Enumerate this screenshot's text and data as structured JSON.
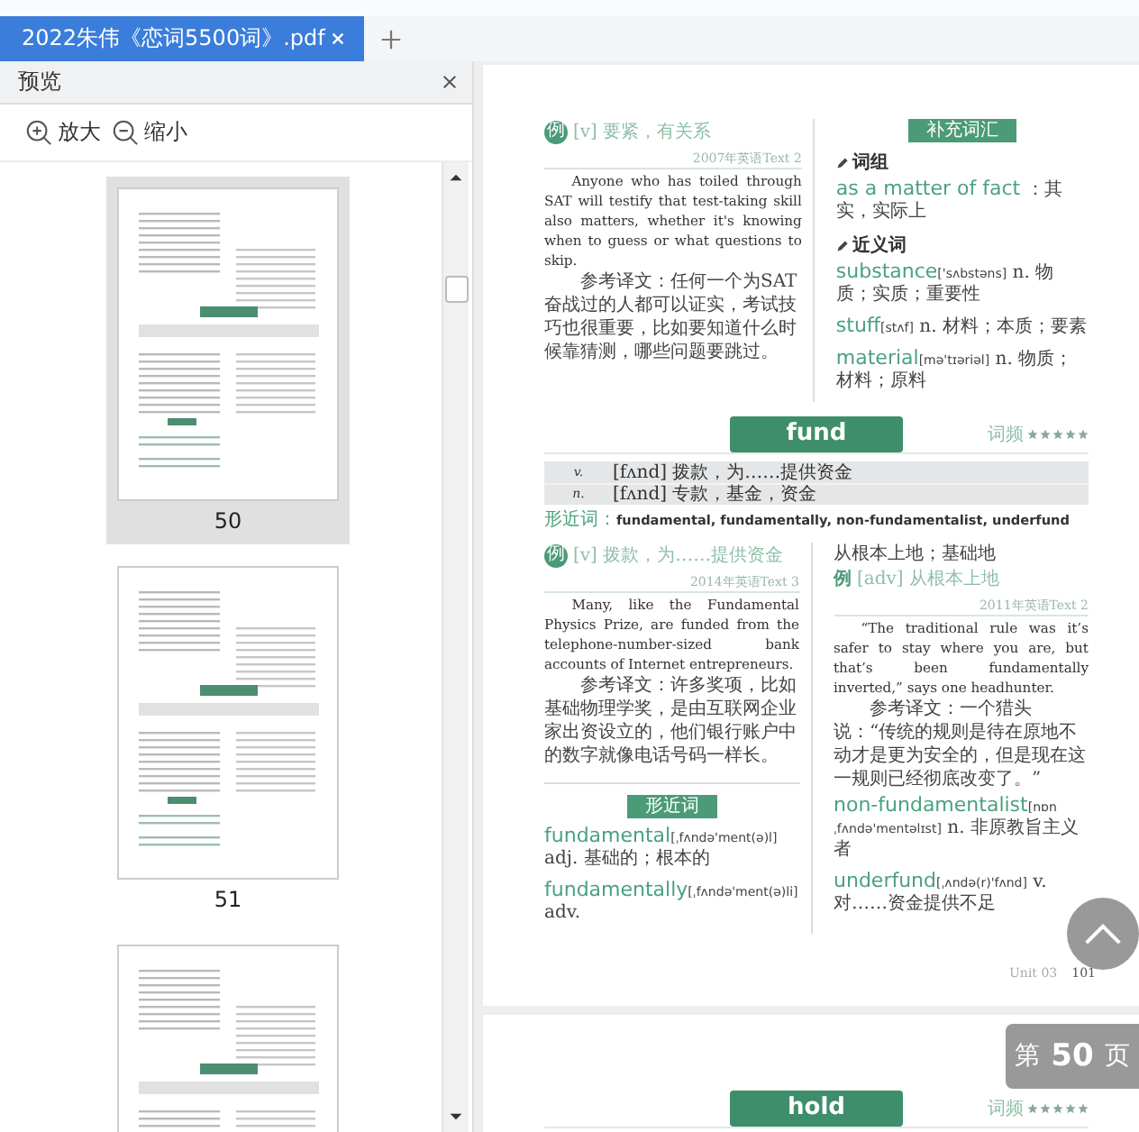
{
  "tab_bar": {
    "tabs": [
      {
        "label": "2022朱伟《恋词5500词》.pdf",
        "selected": true
      }
    ]
  },
  "sidebar": {
    "title": "预览",
    "zoom_in": "放大",
    "zoom_out": "缩小",
    "thumbnails": [
      {
        "page": "50",
        "selected": true
      },
      {
        "page": "51",
        "selected": false
      },
      {
        "selected": false
      }
    ]
  },
  "document": {
    "example_1": {
      "kind": "circle",
      "badge": "例",
      "sense": "[v] 要紧，有关系",
      "source": "2007年英语Text 2",
      "english": "Anyone who has toiled through SAT will testify that test-taking skill also matters, whether it's knowing when to guess or what questions to skip.",
      "translation": "参考译文：任何一个为SAT奋战过的人都可以证实，考试技巧也很重要，比如要知道什么时候靠猜测，哪些问题要跳过。"
    },
    "supplement": {
      "title": "补充词汇",
      "sections": [
        {
          "heading": "词组",
          "entries": [
            {
              "word": "as a matter of fact",
              "definition": "：其实，实际上"
            }
          ]
        },
        {
          "heading": "近义词",
          "entries": [
            {
              "word": "substance",
              "phonetic": "['sʌbstəns]",
              "definition": "n. 物质；实质；重要性"
            },
            {
              "word": "stuff",
              "phonetic": "[stʌf]",
              "definition": "n. 材料；本质；要素"
            },
            {
              "word": "material",
              "phonetic": "[mə'tɪəriəl]",
              "definition": "n. 物质；材料；原料"
            }
          ]
        }
      ]
    },
    "word_banner": {
      "word": "fund",
      "frequency_label": "词频",
      "stars": 5
    },
    "definitions": [
      {
        "pos": "v.",
        "text": "[fʌnd] 拨款，为……提供资金"
      },
      {
        "pos": "n.",
        "text": "[fʌnd] 专款，基金，资金"
      }
    ],
    "similar_words": {
      "label": "形近词：",
      "words": "fundamental, fundamentally, non-fundamentalist, underfund"
    },
    "example_2": {
      "kind": "circle",
      "badge": "例",
      "sense": "[v] 拨款，为……提供资金",
      "source": "2014年英语Text 3",
      "english": "Many, like the Fundamental Physics Prize, are funded from the telephone-number-sized bank accounts of Internet entrepreneurs.",
      "translation": "参考译文：许多奖项，比如基础物理学奖，是由互联网企业家出资设立的，他们银行账户中的数字就像电话号码一样长。"
    },
    "similar_section": {
      "title": "形近词",
      "entries": [
        {
          "word": "fundamental",
          "phonetic": "[ˌfʌndə'ment(ə)l]",
          "definition": "adj. 基础的；根本的"
        },
        {
          "word": "fundamentally",
          "phonetic": "[ˌfʌndə'ment(ə)li]",
          "definition": "adv."
        }
      ]
    },
    "continuation": "从根本上地；基础地",
    "example_3": {
      "kind": "inline",
      "badge": "例",
      "sense": "[adv] 从根本上地",
      "source": "2011年英语Text 2",
      "english": "“The traditional rule was it’s safer to stay where you are, but that’s been fundamentally inverted,” says one headhunter.",
      "translation": "参考译文：一个猎头说：“传统的规则是待在原地不动才是更为安全的，但是现在这一规则已经彻底改变了。”"
    },
    "right_entries": [
      {
        "word": "non-fundamentalist",
        "phonetic": "[nɒnˌfʌndə'mentəlɪst]",
        "definition": "n. 非原教旨主义者"
      },
      {
        "word": "underfund",
        "phonetic": "[ˌʌndə(r)'fʌnd]",
        "definition": "v. 对……资金提供不足"
      }
    ],
    "footer": {
      "unit": "Unit 03",
      "page": "101"
    }
  },
  "next_page": {
    "word_banner": {
      "word": "hold",
      "frequency_label": "词频",
      "stars": 5
    }
  },
  "page_indicator": {
    "prefix": "第",
    "page": "50",
    "suffix": "页"
  }
}
